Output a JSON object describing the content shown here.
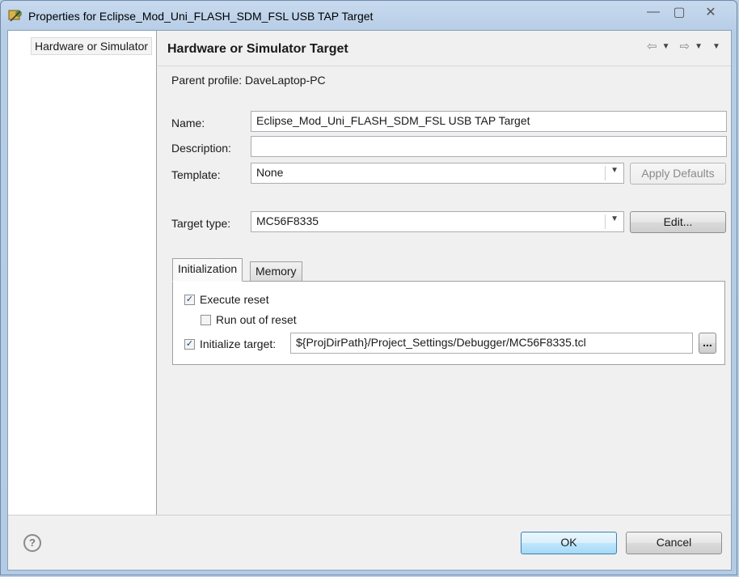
{
  "window": {
    "title": "Properties for Eclipse_Mod_Uni_FLASH_SDM_FSL USB TAP Target",
    "buttons": {
      "minimize": "—",
      "maximize": "▢",
      "close": "✕"
    }
  },
  "tree": {
    "items": [
      {
        "label": "Hardware or Simulator"
      }
    ]
  },
  "page": {
    "title": "Hardware or Simulator Target",
    "parent_profile": "Parent profile: DaveLaptop-PC",
    "name_label": "Name:",
    "name_value": "Eclipse_Mod_Uni_FLASH_SDM_FSL USB TAP Target",
    "description_label": "Description:",
    "description_value": "",
    "template_label": "Template:",
    "template_value": "None",
    "apply_defaults": "Apply Defaults",
    "target_type_label": "Target type:",
    "target_type_value": "MC56F8335",
    "edit_button": "Edit..."
  },
  "tabs": [
    {
      "label": "Initialization",
      "active": true
    },
    {
      "label": "Memory",
      "active": false
    }
  ],
  "initialization": {
    "execute_reset": {
      "label": "Execute reset",
      "checked": true
    },
    "run_out_of_reset": {
      "label": "Run out of reset",
      "checked": false
    },
    "initialize_target": {
      "label": "Initialize target:",
      "checked": true,
      "path": "${ProjDirPath}/Project_Settings/Debugger/MC56F8335.tcl",
      "browse": "..."
    }
  },
  "footer": {
    "help": "?",
    "ok": "OK",
    "cancel": "Cancel"
  },
  "colors": {
    "titlebar": "#c7d9ee",
    "dialog_bg": "#f0f0f0",
    "default_button_border": "#3c7fb1"
  },
  "icons": [
    "app-icon",
    "back-arrow-icon",
    "forward-arrow-icon",
    "dropdown-icon",
    "help-icon"
  ]
}
